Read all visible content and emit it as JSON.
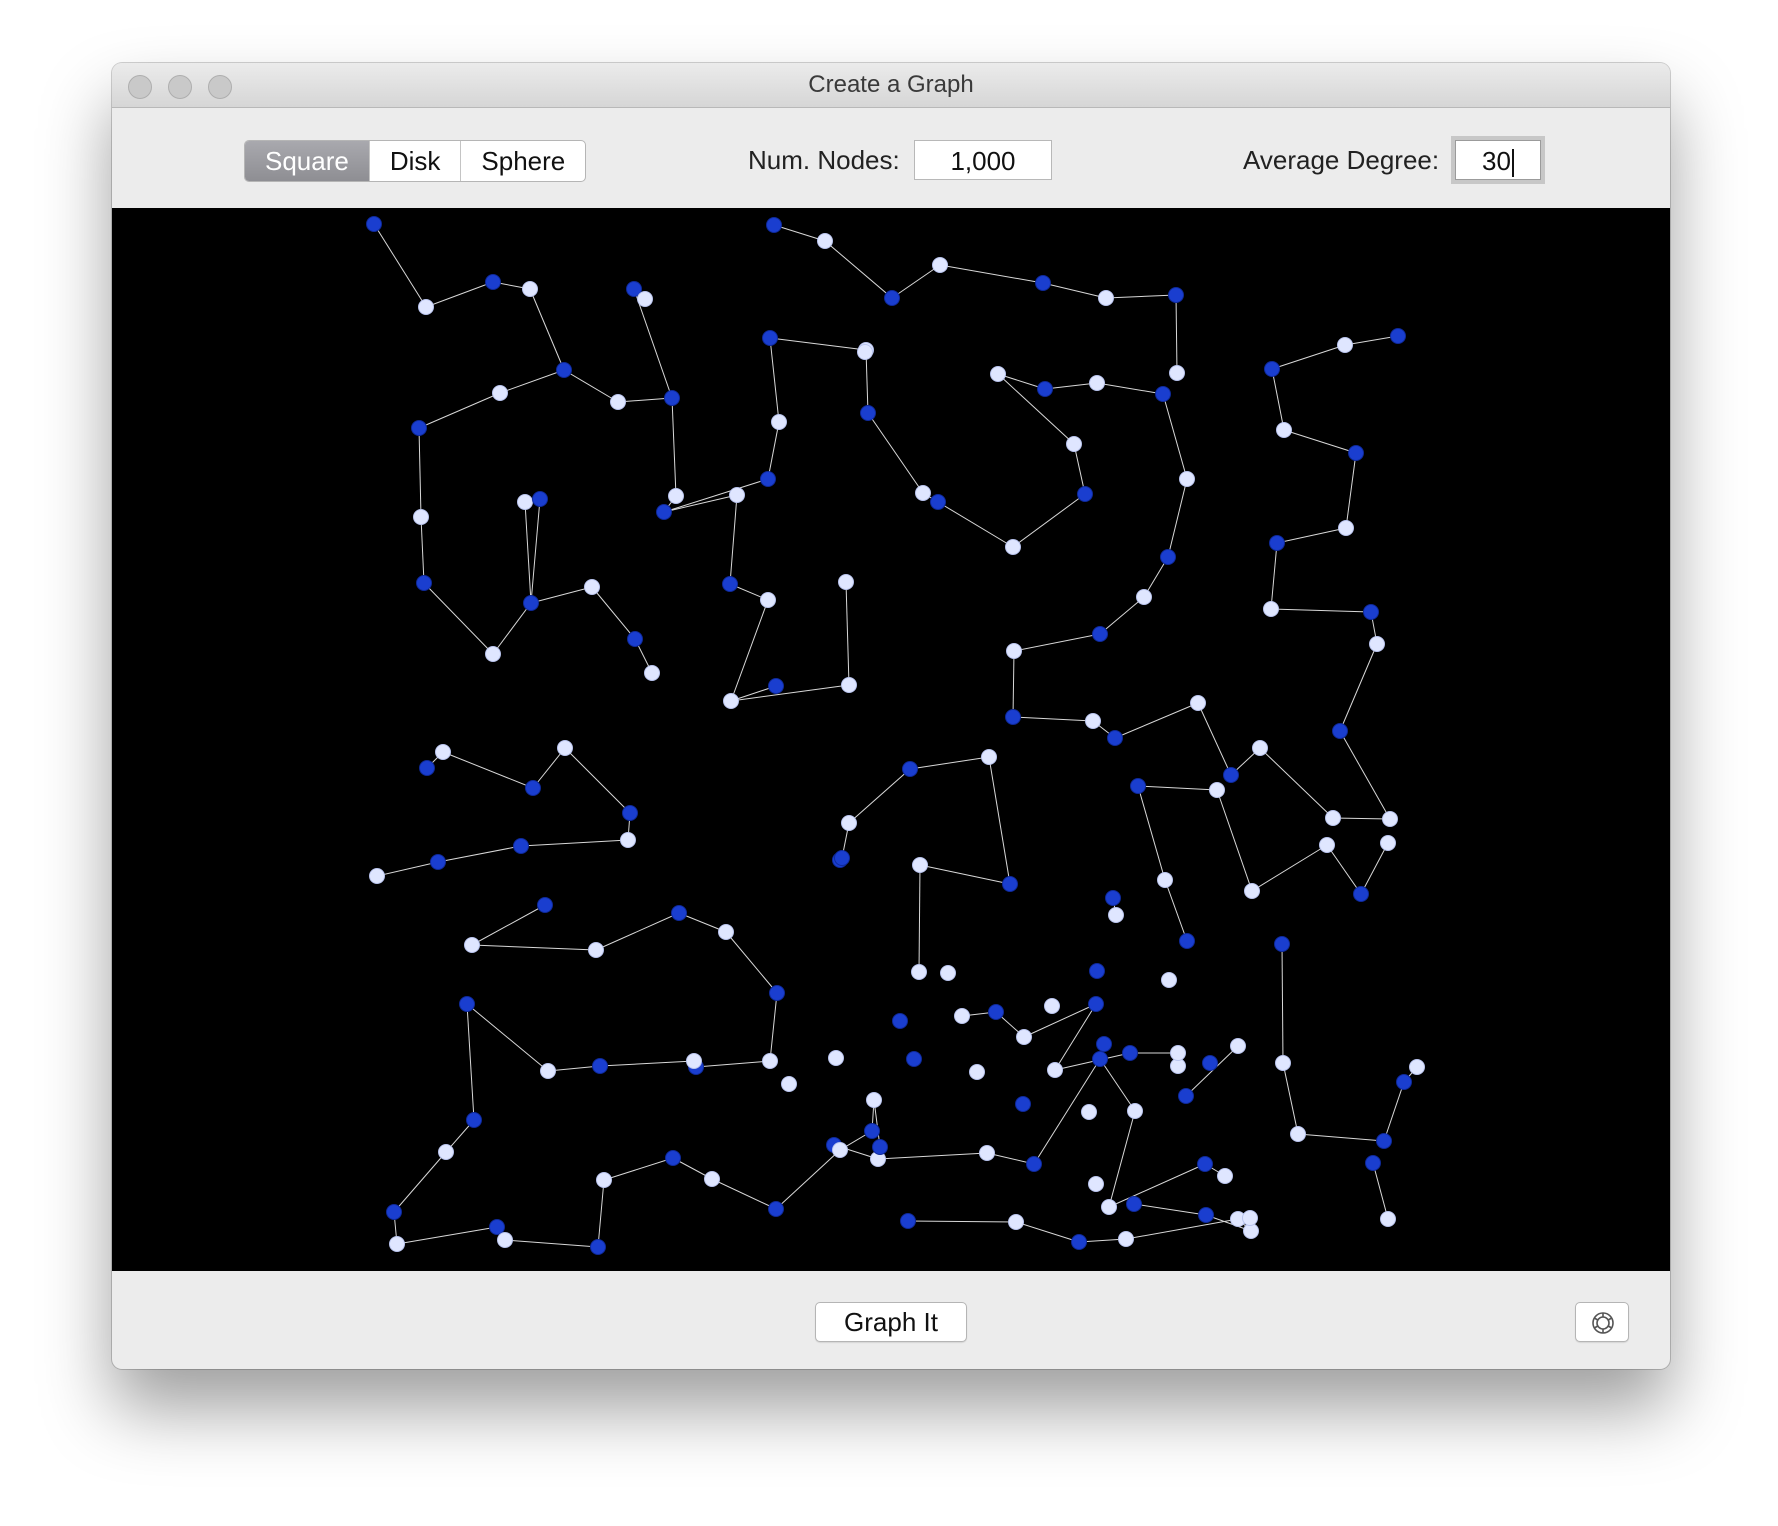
{
  "window": {
    "title": "Create a Graph"
  },
  "toolbar": {
    "shape_options": [
      {
        "label": "Square",
        "selected": true
      },
      {
        "label": "Disk",
        "selected": false
      },
      {
        "label": "Sphere",
        "selected": false
      }
    ],
    "num_nodes_label": "Num. Nodes:",
    "num_nodes_value": "1,000",
    "avg_degree_label": "Average Degree:",
    "avg_degree_value": "30"
  },
  "footer": {
    "graph_button_label": "Graph It",
    "settings_icon": "gear-icon"
  },
  "colors": {
    "canvas_background": "#000000",
    "node_blue": "#1a3ecf",
    "node_light": "#dfe6ff",
    "edge": "#d8d8d8",
    "segment_selected": "#8e8e93"
  }
}
